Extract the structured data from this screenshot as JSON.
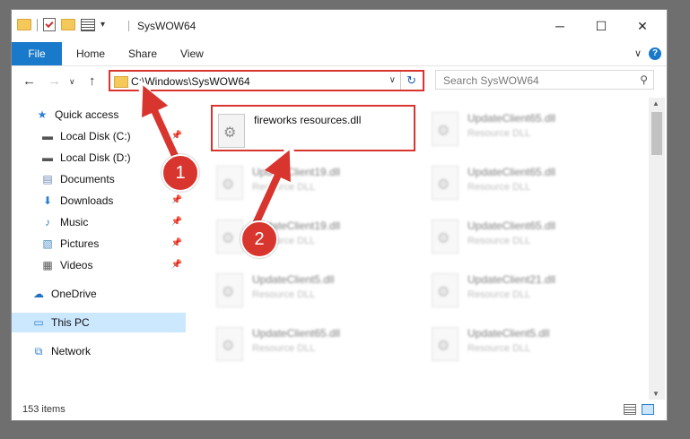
{
  "window": {
    "title": "SysWOW64"
  },
  "controls": {
    "minimize": "─",
    "maximize": "☐",
    "close": "✕"
  },
  "ribbon": {
    "tabs": [
      "File",
      "Home",
      "Share",
      "View"
    ],
    "help": "?"
  },
  "address": {
    "path": "C:\\Windows\\SysWOW64"
  },
  "search": {
    "placeholder": "Search SysWOW64"
  },
  "sidebar": [
    {
      "label": "Quick access",
      "icon": "star-icon",
      "pinned": false
    },
    {
      "label": "Local Disk (C:)",
      "icon": "drive-icon",
      "pinned": true
    },
    {
      "label": "Local Disk (D:)",
      "icon": "drive-icon",
      "pinned": false
    },
    {
      "label": "Documents",
      "icon": "documents-icon",
      "pinned": true
    },
    {
      "label": "Downloads",
      "icon": "download-icon",
      "pinned": true
    },
    {
      "label": "Music",
      "icon": "music-icon",
      "pinned": true
    },
    {
      "label": "Pictures",
      "icon": "pictures-icon",
      "pinned": true
    },
    {
      "label": "Videos",
      "icon": "videos-icon",
      "pinned": true
    },
    {
      "label": "OneDrive",
      "icon": "cloud-icon",
      "pinned": false
    },
    {
      "label": "This PC",
      "icon": "computer-icon",
      "pinned": false,
      "selected": true
    },
    {
      "label": "Network",
      "icon": "network-icon",
      "pinned": false
    }
  ],
  "files": [
    {
      "name": "fireworks resources.dll",
      "type": "",
      "highlighted": true
    },
    {
      "name": "UpdateClient65.dll",
      "type": "Resource DLL"
    },
    {
      "name": "UpdateClient19.dll",
      "type": "Resource DLL"
    },
    {
      "name": "UpdateClient65.dll",
      "type": "Resource DLL"
    },
    {
      "name": "UpdateClient19.dll",
      "type": "Resource DLL"
    },
    {
      "name": "UpdateClient65.dll",
      "type": "Resource DLL"
    },
    {
      "name": "UpdateClient5.dll",
      "type": "Resource DLL"
    },
    {
      "name": "UpdateClient21.dll",
      "type": "Resource DLL"
    },
    {
      "name": "UpdateClient65.dll",
      "type": "Resource DLL"
    },
    {
      "name": "UpdateClient5.dll",
      "type": "Resource DLL"
    }
  ],
  "status": {
    "count": "153 items"
  },
  "annotations": [
    {
      "label": "1"
    },
    {
      "label": "2"
    }
  ],
  "colors": {
    "accent": "#1979ca",
    "highlight": "#d9352f",
    "selected": "#cce8ff"
  }
}
